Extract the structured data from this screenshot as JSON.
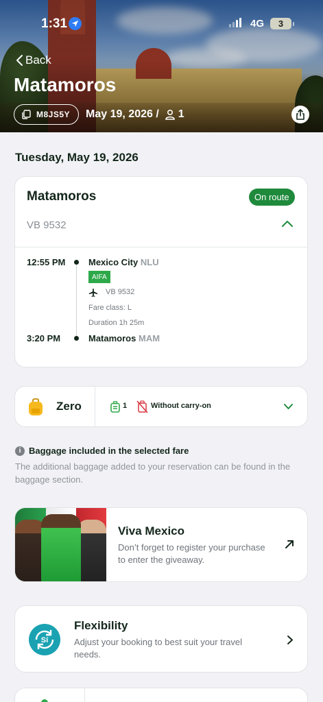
{
  "status_bar": {
    "time": "1:31",
    "network": "4G",
    "battery": "3"
  },
  "header": {
    "back_label": "Back",
    "city": "Matamoros",
    "reservation_code": "M8JS5Y",
    "date_pax": "May 19, 2026 /",
    "passengers": "1"
  },
  "trip": {
    "date_heading": "Tuesday, May 19, 2026",
    "destination": "Matamoros",
    "status_badge": "On route",
    "flight_number": "VB 9532",
    "departure": {
      "time": "12:55 PM",
      "city": "Mexico City",
      "code": "NLU",
      "airport_tag": "AIFA"
    },
    "segment": {
      "flight": "VB 9532",
      "fare_class": "Fare class: L",
      "duration": "Duration 1h 25m"
    },
    "arrival": {
      "time": "3:20 PM",
      "city": "Matamoros",
      "code": "MAM"
    }
  },
  "baggage": {
    "fare_name": "Zero",
    "checked_count": "1",
    "carry_on_label": "Without carry-on",
    "info_title": "Baggage included in the selected fare",
    "info_text": "The additional baggage added to your reservation can be found in the baggage section."
  },
  "promo": {
    "title": "Viva Mexico",
    "description": "Don’t forget to register your purchase to enter the giveaway."
  },
  "flexibility": {
    "title": "Flexibility",
    "description": "Adjust your booking to best suit your travel needs.",
    "icon_text": "Sí"
  },
  "colors": {
    "brand_green": "#1f8a3c",
    "accent_green": "#2ea94a",
    "text_dark": "#13261a",
    "background": "#f2f2f6"
  }
}
